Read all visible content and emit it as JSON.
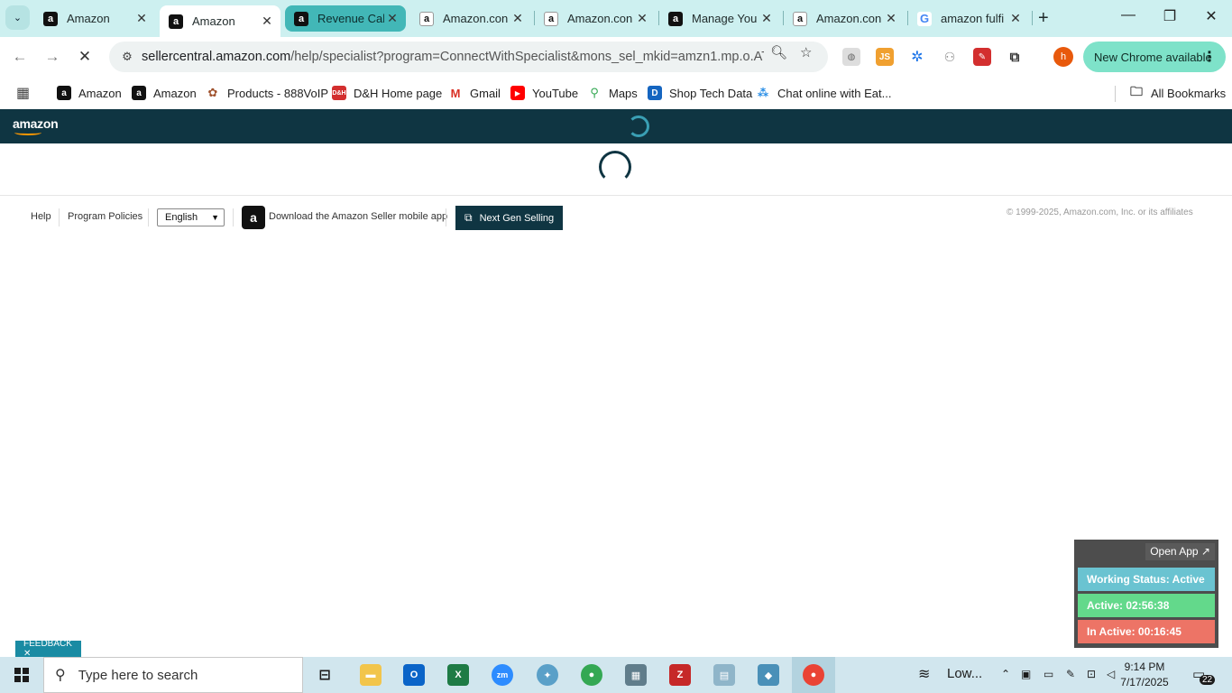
{
  "browser": {
    "tabs": [
      {
        "title": "Amazon",
        "favicon": "amazon-icon",
        "state": "normal"
      },
      {
        "title": "Amazon",
        "favicon": "amazon-icon",
        "state": "active"
      },
      {
        "title": "Revenue Cal",
        "favicon": "amazon-icon",
        "state": "grouped"
      },
      {
        "title": "Amazon.con",
        "favicon": "amazon-icon",
        "state": "normal"
      },
      {
        "title": "Amazon.con",
        "favicon": "amazon-icon",
        "state": "normal"
      },
      {
        "title": "Manage You",
        "favicon": "amazon-icon",
        "state": "normal"
      },
      {
        "title": "Amazon.con",
        "favicon": "amazon-icon",
        "state": "normal"
      },
      {
        "title": "amazon fulfi",
        "favicon": "google-icon",
        "state": "normal"
      }
    ],
    "url_host": "sellercentral.amazon.com",
    "url_path": "/help/specialist?program=ConnectWithSpecialist&mons_sel_mkid=amzn1.mp.o.ATV...",
    "update_button": "New Chrome available",
    "bookmarks": [
      {
        "label": "Amazon"
      },
      {
        "label": "Amazon"
      },
      {
        "label": "Products - 888VoIP"
      },
      {
        "label": "D&H Home page"
      },
      {
        "label": "Gmail"
      },
      {
        "label": "YouTube"
      },
      {
        "label": "Maps"
      },
      {
        "label": "Shop Tech Data"
      },
      {
        "label": "Chat online with Eat..."
      }
    ],
    "all_bookmarks": "All Bookmarks",
    "profile_initial": "h"
  },
  "page": {
    "logo": "amazon",
    "footer": {
      "help": "Help",
      "program_policies": "Program Policies",
      "language": "English",
      "download_app": "Download the Amazon Seller mobile app",
      "next_gen": "Next Gen Selling",
      "copyright": "© 1999-2025, Amazon.com, Inc. or its affiliates"
    },
    "feedback": "FEEDBACK ✕"
  },
  "widget": {
    "open_app": "Open App ↗",
    "working_status": "Working Status: Active",
    "active_time": "Active: 02:56:38",
    "inactive_time": "In Active: 00:16:45"
  },
  "taskbar": {
    "search_placeholder": "Type here to search",
    "weather": "Low...",
    "time": "9:14 PM",
    "date": "7/17/2025",
    "notification_count": "22"
  },
  "colors": {
    "tabstrip": "#cdf0f0",
    "amazon_header": "#0f3542",
    "update_button": "#7ee2c9",
    "widget_status": "#6ac3d1",
    "widget_active": "#63d98b",
    "widget_inactive": "#ed7466"
  }
}
